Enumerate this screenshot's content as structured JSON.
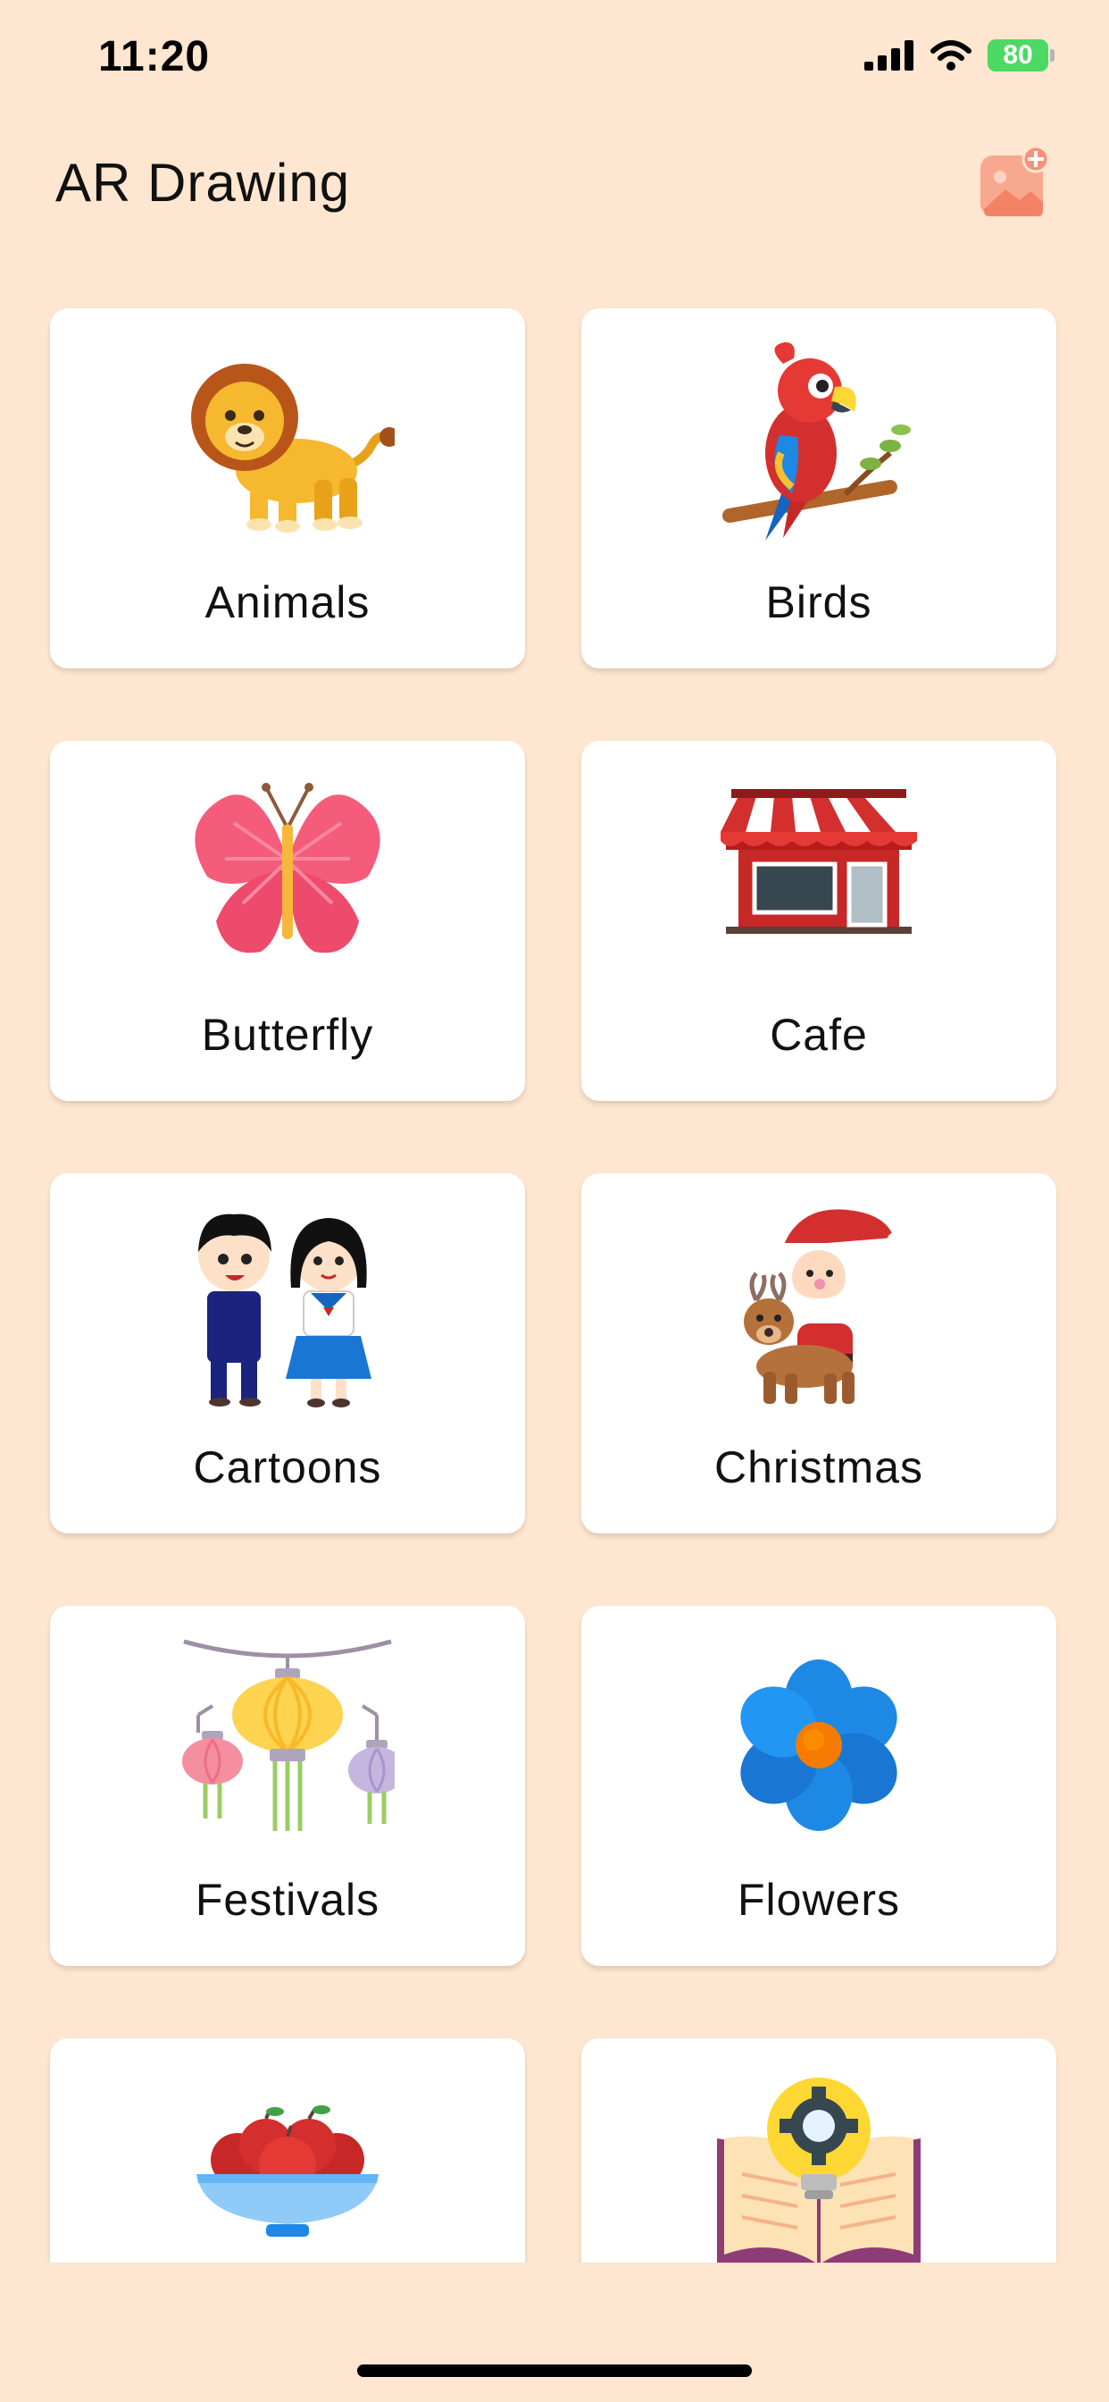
{
  "status_bar": {
    "time": "11:20",
    "battery": "80"
  },
  "header": {
    "title": "AR Drawing"
  },
  "categories": [
    {
      "label": "Animals"
    },
    {
      "label": "Birds"
    },
    {
      "label": "Butterfly"
    },
    {
      "label": "Cafe"
    },
    {
      "label": "Cartoons"
    },
    {
      "label": "Christmas"
    },
    {
      "label": "Festivals"
    },
    {
      "label": "Flowers"
    },
    {
      "label": ""
    },
    {
      "label": ""
    }
  ],
  "colors": {
    "background": "#FEE6D0",
    "card": "#FFFFFF",
    "accent": "#F7917A"
  },
  "icons": {
    "add_photo": "add-photo-icon",
    "category_0": "lion-icon",
    "category_1": "parrot-icon",
    "category_2": "butterfly-icon",
    "category_3": "shop-icon",
    "category_4": "cartoon-kids-icon",
    "category_5": "santa-reindeer-icon",
    "category_6": "lanterns-icon",
    "category_7": "flower-icon",
    "category_8": "fruit-bowl-icon",
    "category_9": "book-idea-icon"
  }
}
